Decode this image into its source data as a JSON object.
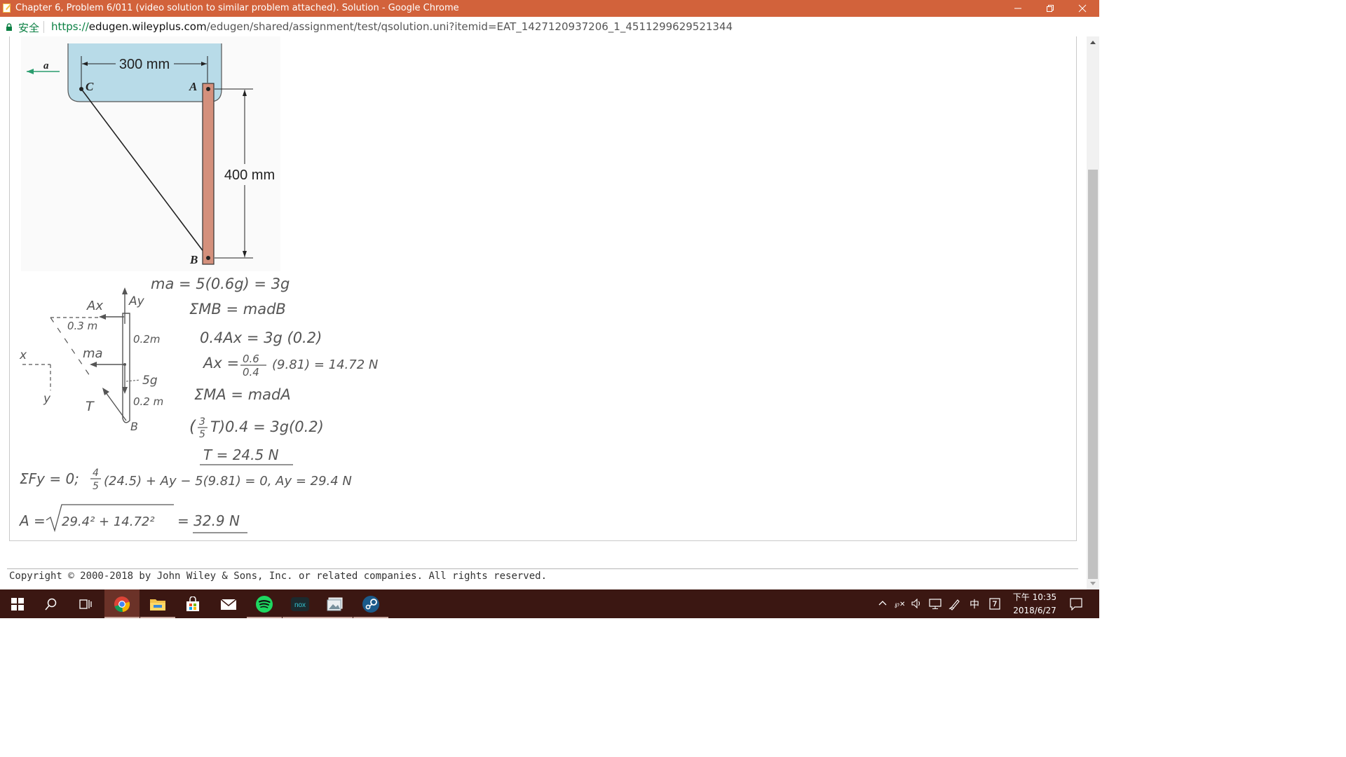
{
  "window": {
    "title": "Chapter 6, Problem 6/011 (video solution to similar problem attached). Solution - Google Chrome",
    "accent": "#d2623b"
  },
  "address_bar": {
    "secure_label": "安全",
    "url_scheme": "https://",
    "url_host": "edugen.wileyplus.com",
    "url_path": "/edugen/shared/assignment/test/qsolution.uni?itemid=EAT_1427120937206_1_4511299629521344"
  },
  "figure": {
    "accel_label": "a",
    "width_label": "300 mm",
    "height_label": "400 mm",
    "point_c": "C",
    "point_a": "A",
    "point_b": "B",
    "tank_color": "#b8dbe8",
    "bar_color": "#d4907c"
  },
  "fbd": {
    "ax": "Ax",
    "ay": "Ay",
    "dim_03": "0.3 m",
    "dim_02_top": "0.2m",
    "dim_02_bottom": "0.2 m",
    "ma": "ma",
    "weight": "5g",
    "tension": "T",
    "point_b": "B",
    "x_axis": "x",
    "y_axis": "y"
  },
  "solution": {
    "line1": "ma = 5(0.6g) = 3g",
    "line2": "ΣMB = madB",
    "line3": "0.4Ax = 3g (0.2)",
    "line4_lhs": "Ax =",
    "line4_num": "0.6",
    "line4_den": "0.4",
    "line4_rhs": "(9.81) = 14.72 N",
    "line5": "ΣMA = madA",
    "line6_num": "3",
    "line6_den": "5",
    "line6": "T)0.4 = 3g(0.2)",
    "line7": "T = 24.5  N",
    "line8_lhs": "ΣFy = 0;",
    "line8_num": "4",
    "line8_den": "5",
    "line8_rhs": "(24.5) + Ay − 5(9.81) = 0,   Ay = 29.4 N",
    "line9_lhs": "A =",
    "line9_radicand": "29.4² + 14.72²",
    "line9_rhs": "= 32.9 N"
  },
  "footer": {
    "copyright": "Copyright © 2000-2018 by John Wiley & Sons, Inc. or related companies. All rights reserved."
  },
  "taskbar": {
    "time": "下午 10:35",
    "date": "2018/6/27",
    "ime": "中",
    "nox_label": "nox",
    "color": "#3b1712",
    "icons": [
      "windows-start-icon",
      "search-icon",
      "task-view-icon",
      "chrome-icon",
      "file-explorer-icon",
      "store-icon",
      "mail-icon",
      "spotify-icon",
      "nox-icon",
      "photos-icon",
      "steam-icon"
    ]
  }
}
